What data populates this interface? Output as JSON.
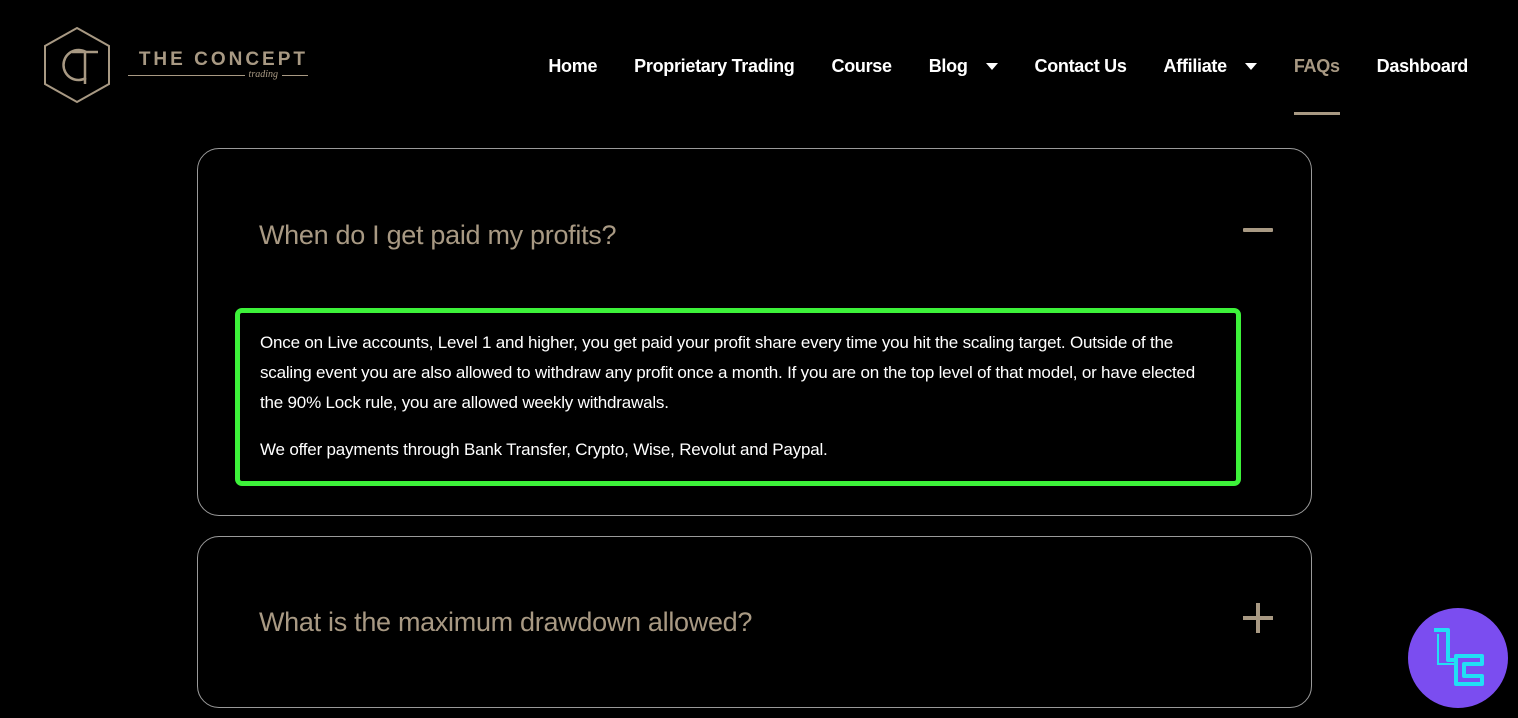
{
  "brand": {
    "title": "THE CONCEPT",
    "subtitle": "trading",
    "accent_color": "#a89983"
  },
  "nav": {
    "items": [
      {
        "label": "Home",
        "has_dropdown": false,
        "active": false
      },
      {
        "label": "Proprietary Trading",
        "has_dropdown": false,
        "active": false
      },
      {
        "label": "Course",
        "has_dropdown": false,
        "active": false
      },
      {
        "label": "Blog",
        "has_dropdown": true,
        "active": false
      },
      {
        "label": "Contact Us",
        "has_dropdown": false,
        "active": false
      },
      {
        "label": "Affiliate",
        "has_dropdown": true,
        "active": false
      },
      {
        "label": "FAQs",
        "has_dropdown": false,
        "active": true
      },
      {
        "label": "Dashboard",
        "has_dropdown": false,
        "active": false
      }
    ]
  },
  "faq": {
    "items": [
      {
        "question": "When do I get paid my profits?",
        "expanded": true,
        "answer": [
          "Once on Live accounts, Level 1 and higher, you get paid your profit share every time you hit the scaling target. Outside of the scaling event you are also allowed to withdraw any profit once a month. If you are on the top level of that model, or have elected the 90% Lock rule, you are allowed weekly withdrawals.",
          "We offer payments through Bank Transfer, Crypto, Wise, Revolut and Paypal."
        ]
      },
      {
        "question": "What is the maximum drawdown allowed?",
        "expanded": false
      }
    ]
  },
  "colors": {
    "background": "#000000",
    "highlight": "#3df23a",
    "badge": "#7b4df0",
    "badge_glyph": "#22e0f5"
  },
  "icons": {
    "logo": "hexagon-ct-logo-icon",
    "dropdown": "chevron-down-icon",
    "collapse": "minus-icon",
    "expand": "plus-icon",
    "badge": "tc-badge-icon"
  }
}
